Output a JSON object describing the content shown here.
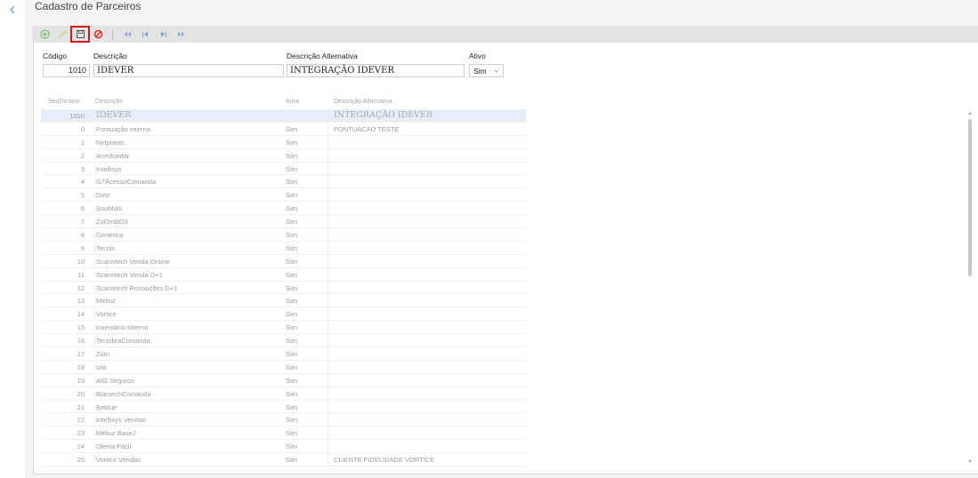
{
  "page": {
    "title": "Cadastro de Parceiros"
  },
  "toolbar": {
    "buttons": [
      {
        "name": "add-button",
        "icon": "plus-circle-icon",
        "color": "#5cb85c"
      },
      {
        "name": "edit-button",
        "icon": "pencil-icon",
        "color": "#9ccc65"
      },
      {
        "name": "save-button",
        "icon": "floppy-disk-icon",
        "color": "#555555",
        "highlighted": true
      },
      {
        "name": "cancel-button",
        "icon": "ban-icon",
        "color": "#d9342b"
      },
      {
        "name": "first-record-button",
        "icon": "double-chevron-left-icon",
        "color": "#7aa7d8"
      },
      {
        "name": "previous-record-button",
        "icon": "skip-back-icon",
        "color": "#7aa7d8"
      },
      {
        "name": "next-record-button",
        "icon": "skip-forward-icon",
        "color": "#7aa7d8"
      },
      {
        "name": "last-record-button",
        "icon": "double-chevron-right-icon",
        "color": "#7aa7d8"
      }
    ]
  },
  "form": {
    "codigo_label": "Código",
    "codigo_value": "1010",
    "descricao_label": "Descrição",
    "descricao_value": "IDEVER",
    "desc_alt_label": "Descrição Alternativa",
    "desc_alt_value": "INTEGRAÇÃO IDEVER",
    "ativo_label": "Ativo",
    "ativo_value": "Sim"
  },
  "grid": {
    "columns": [
      "SeqDestino",
      "Descrição",
      "Ativo",
      "Descrição Alternativa"
    ],
    "rows": [
      {
        "seq": "1010",
        "desc": "IDEVER",
        "ativo": "",
        "alt": "INTEGRAÇÃO IDEVER",
        "selected": true
      },
      {
        "seq": "0",
        "desc": "Pontuação interna",
        "ativo": "Sim",
        "alt": "PONTUACAO TESTE"
      },
      {
        "seq": "1",
        "desc": "Netpoints",
        "ativo": "Sim",
        "alt": ""
      },
      {
        "seq": "2",
        "desc": "Arredondar",
        "ativo": "Sim",
        "alt": ""
      },
      {
        "seq": "3",
        "desc": "Intellisys",
        "ativo": "Sim",
        "alt": ""
      },
      {
        "seq": "4",
        "desc": "G7AcessoComanda",
        "ativo": "Sim",
        "alt": ""
      },
      {
        "seq": "5",
        "desc": "Dotz",
        "ativo": "Sim",
        "alt": ""
      },
      {
        "seq": "6",
        "desc": "SouMais",
        "ativo": "Sim",
        "alt": ""
      },
      {
        "seq": "7",
        "desc": "ZoOmBOX",
        "ativo": "Sim",
        "alt": ""
      },
      {
        "seq": "8",
        "desc": "Genérica",
        "ativo": "Sim",
        "alt": ""
      },
      {
        "seq": "9",
        "desc": "Tecnix",
        "ativo": "Sim",
        "alt": ""
      },
      {
        "seq": "10",
        "desc": "Scanntech Venda Online",
        "ativo": "Sim",
        "alt": ""
      },
      {
        "seq": "11",
        "desc": "Scanntech Venda D+1",
        "ativo": "Sim",
        "alt": ""
      },
      {
        "seq": "12",
        "desc": "Scanntech Promoções D+1",
        "ativo": "Sim",
        "alt": ""
      },
      {
        "seq": "13",
        "desc": "Méliuz",
        "ativo": "Sim",
        "alt": ""
      },
      {
        "seq": "14",
        "desc": "Vortice",
        "ativo": "Sim",
        "alt": ""
      },
      {
        "seq": "15",
        "desc": "Inventário Interno",
        "ativo": "Sim",
        "alt": ""
      },
      {
        "seq": "16",
        "desc": "TecnibraComanda",
        "ativo": "Sim",
        "alt": ""
      },
      {
        "seq": "17",
        "desc": "Zom",
        "ativo": "Sim",
        "alt": ""
      },
      {
        "seq": "18",
        "desc": "Izio",
        "ativo": "Sim",
        "alt": ""
      },
      {
        "seq": "19",
        "desc": "AIG Seguros",
        "ativo": "Sim",
        "alt": ""
      },
      {
        "seq": "20",
        "desc": "BlarsechComanda",
        "ativo": "Sim",
        "alt": ""
      },
      {
        "seq": "21",
        "desc": "Beblue",
        "ativo": "Sim",
        "alt": ""
      },
      {
        "seq": "22",
        "desc": "Intellisys Vendas",
        "ativo": "Sim",
        "alt": ""
      },
      {
        "seq": "23",
        "desc": "Méliuz Base2",
        "ativo": "Sim",
        "alt": ""
      },
      {
        "seq": "24",
        "desc": "Oferta-Fácil",
        "ativo": "Sim",
        "alt": ""
      },
      {
        "seq": "25",
        "desc": "Vortice Vendas",
        "ativo": "Sim",
        "alt": "CLIENTE FIDELIDADE VORTICE"
      }
    ]
  }
}
